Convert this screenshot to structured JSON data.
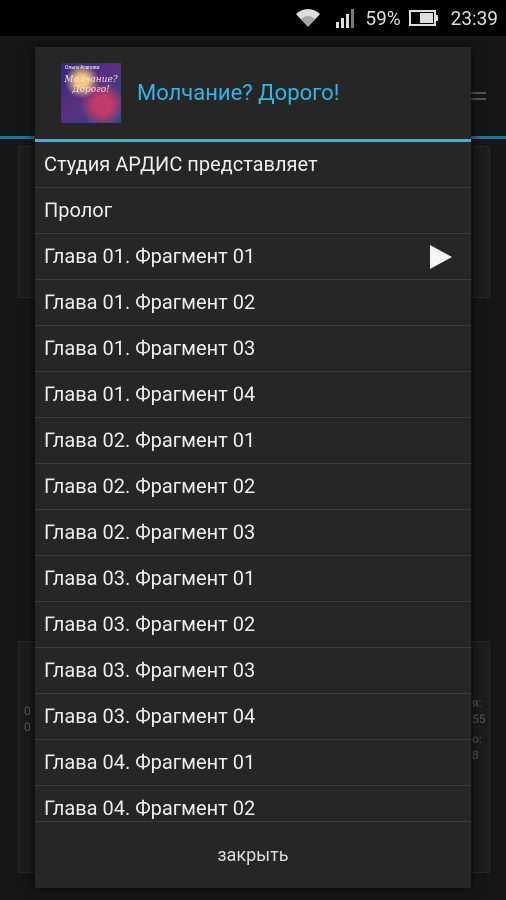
{
  "status_bar": {
    "battery_percent": "59%",
    "time": "23:39",
    "icons": [
      "wifi-icon",
      "signal-icon",
      "battery-icon"
    ]
  },
  "background": {
    "left_fragments": [
      "0",
      "0"
    ],
    "right_fragments": [
      "я:",
      "55",
      "о:",
      "8"
    ]
  },
  "dialog": {
    "title": "Молчание? Дорого!",
    "cover_author": "Ольга Агапова",
    "cover_title": "Молчание? Дорого!",
    "items": [
      {
        "label": "Студия АРДИС представляет"
      },
      {
        "label": "Пролог"
      },
      {
        "label": "Глава 01. Фрагмент 01",
        "playing": true
      },
      {
        "label": "Глава 01. Фрагмент 02"
      },
      {
        "label": "Глава 01. Фрагмент 03"
      },
      {
        "label": "Глава 01. Фрагмент 04"
      },
      {
        "label": "Глава 02. Фрагмент 01"
      },
      {
        "label": "Глава 02. Фрагмент 02"
      },
      {
        "label": "Глава 02. Фрагмент 03"
      },
      {
        "label": "Глава 03. Фрагмент 01"
      },
      {
        "label": "Глава 03. Фрагмент 02"
      },
      {
        "label": "Глава 03. Фрагмент 03"
      },
      {
        "label": "Глава 03. Фрагмент 04"
      },
      {
        "label": "Глава 04. Фрагмент 01"
      },
      {
        "label": "Глава 04. Фрагмент 02"
      }
    ],
    "close_label": "закрыть"
  },
  "colors": {
    "accent": "#33b5e5",
    "dialog_bg": "#262626",
    "divider": "#3b3b3b"
  }
}
